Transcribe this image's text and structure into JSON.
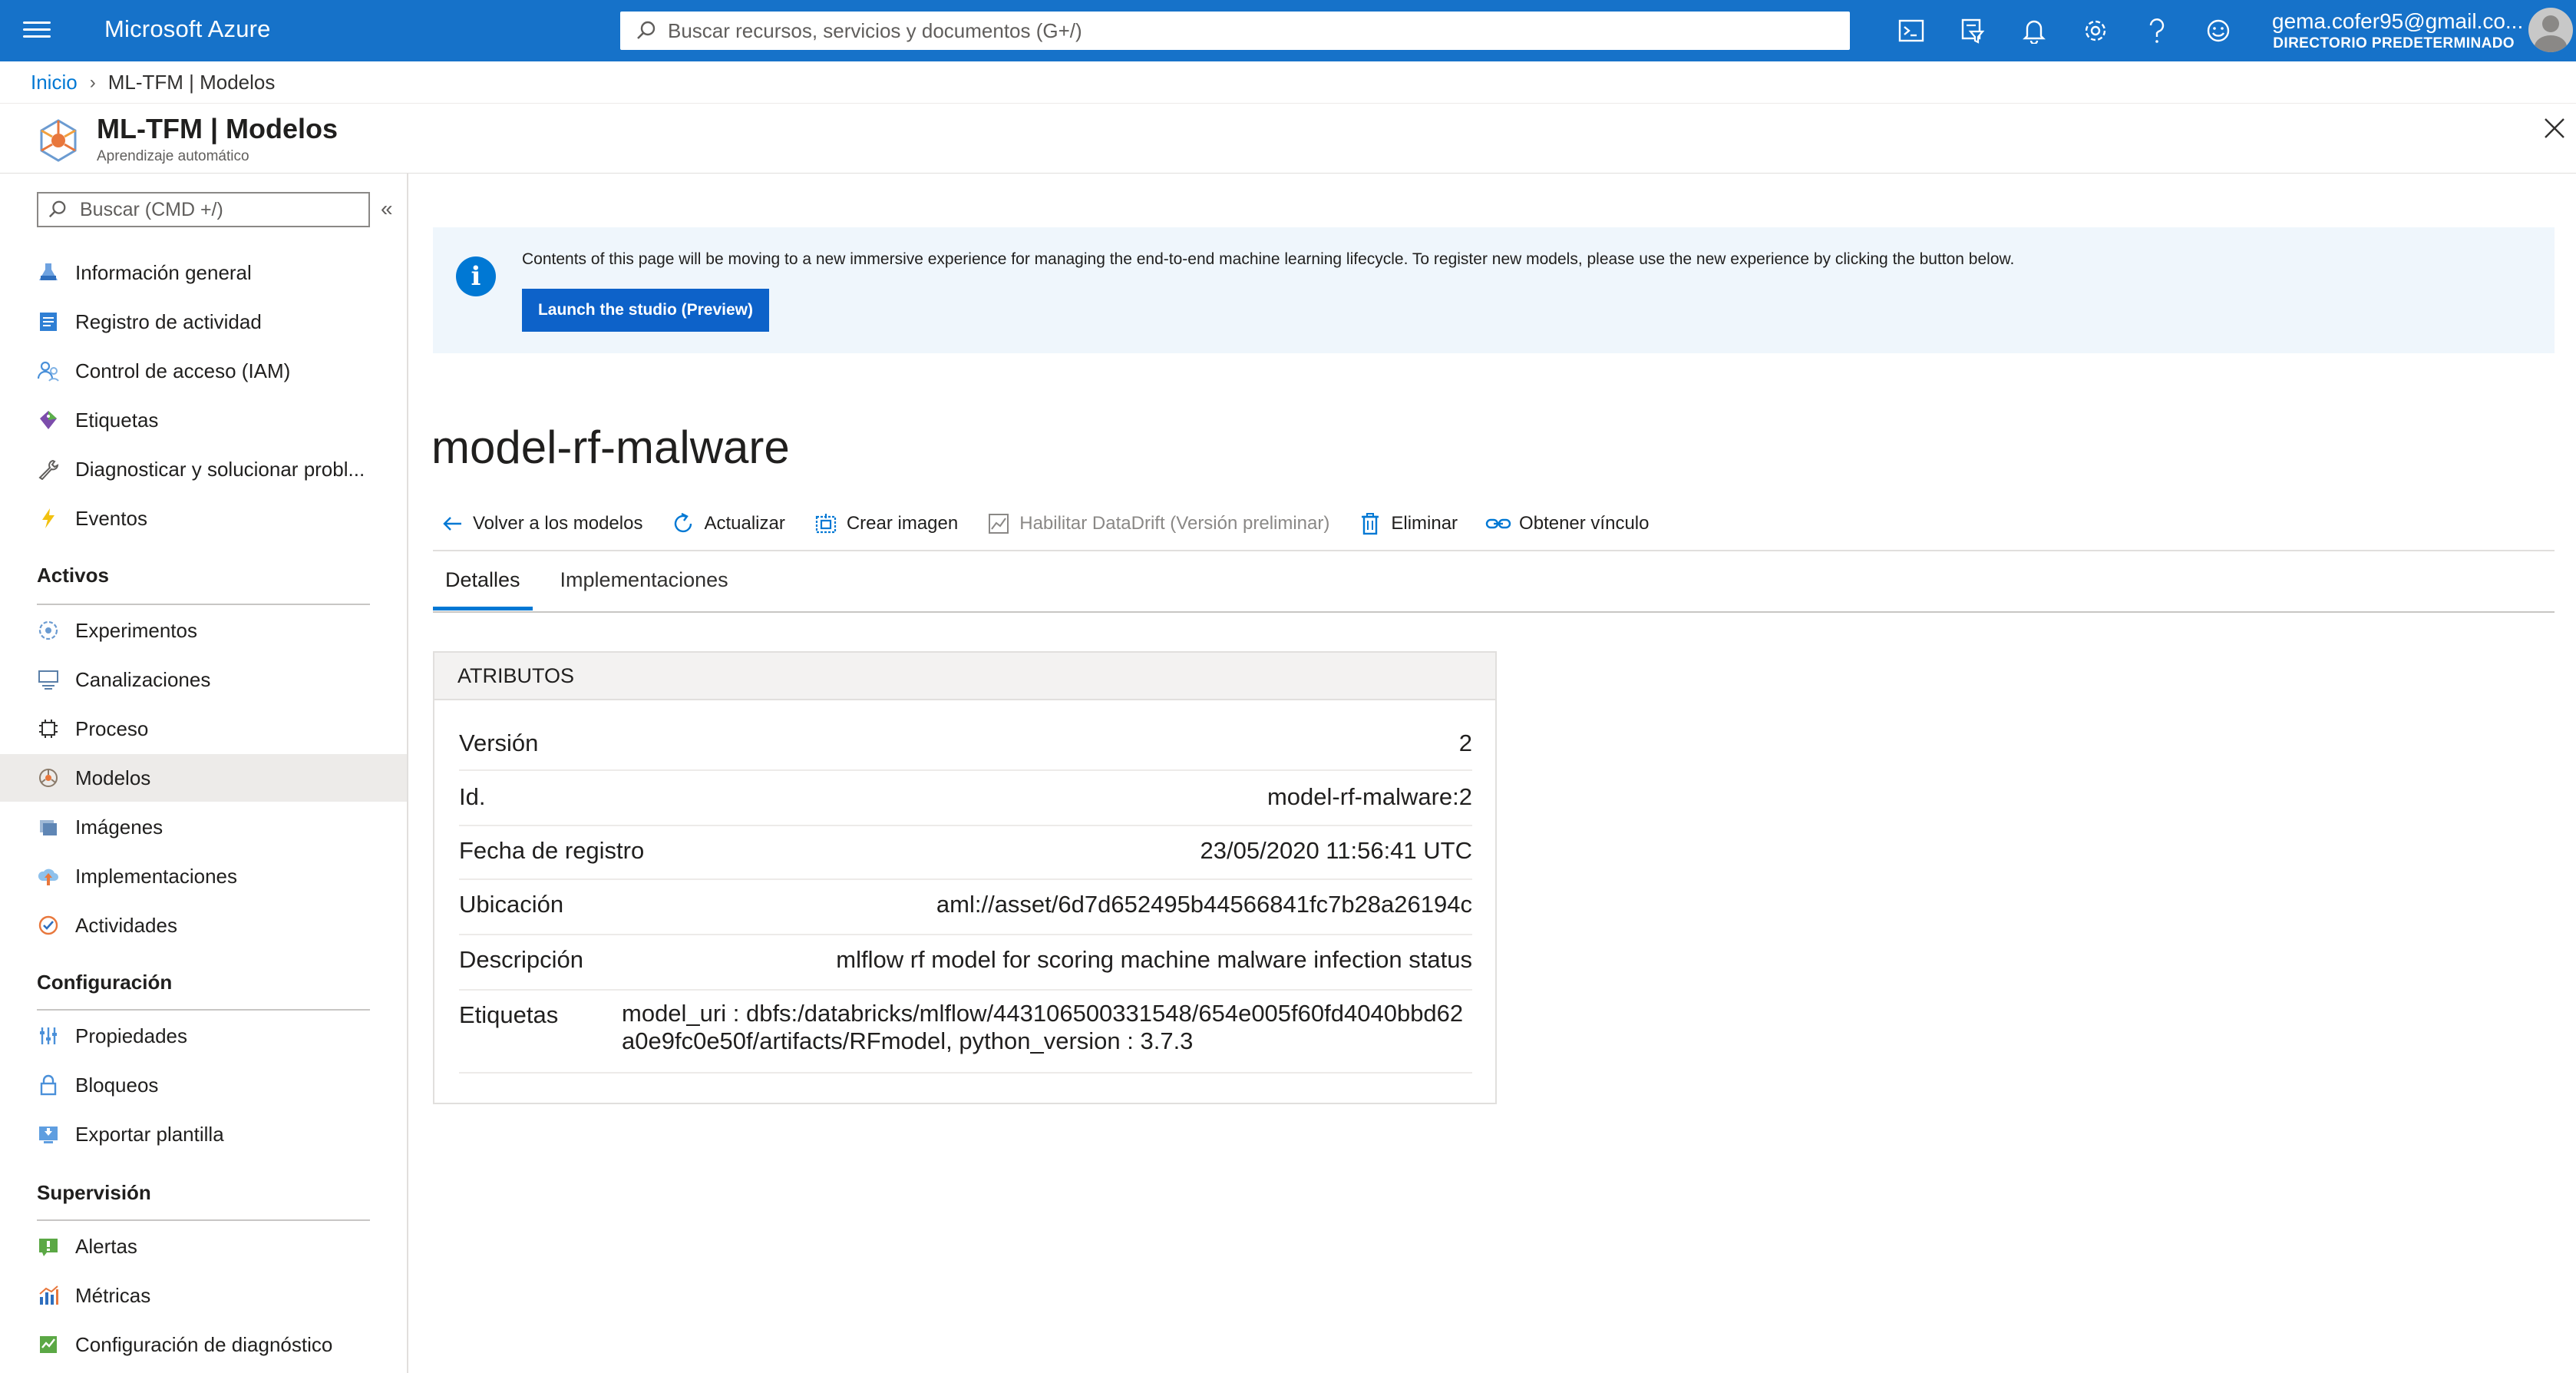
{
  "topbar": {
    "brand": "Microsoft Azure",
    "search_placeholder": "Buscar recursos, servicios y documentos (G+/)",
    "user_email": "gema.cofer95@gmail.co...",
    "user_directory": "DIRECTORIO PREDETERMINADO",
    "icons": [
      "cloud-shell-icon",
      "directory-filter-icon",
      "notifications-icon",
      "settings-icon",
      "help-icon",
      "feedback-icon"
    ]
  },
  "breadcrumb": {
    "home": "Inicio",
    "current": "ML-TFM | Modelos"
  },
  "header": {
    "title": "ML-TFM | Modelos",
    "subtitle": "Aprendizaje automático"
  },
  "sidebar": {
    "search_placeholder": "Buscar (CMD +/)",
    "items_top": [
      {
        "label": "Información general",
        "icon": "overview-icon"
      },
      {
        "label": "Registro de actividad",
        "icon": "activity-log-icon"
      },
      {
        "label": "Control de acceso (IAM)",
        "icon": "iam-icon"
      },
      {
        "label": "Etiquetas",
        "icon": "tags-icon"
      },
      {
        "label": "Diagnosticar y solucionar probl...",
        "icon": "wrench-icon"
      },
      {
        "label": "Eventos",
        "icon": "lightning-icon"
      }
    ],
    "section_activos": "Activos",
    "items_activos": [
      {
        "label": "Experimentos",
        "icon": "experiments-icon"
      },
      {
        "label": "Canalizaciones",
        "icon": "pipelines-icon"
      },
      {
        "label": "Proceso",
        "icon": "compute-icon"
      },
      {
        "label": "Modelos",
        "icon": "models-icon"
      },
      {
        "label": "Imágenes",
        "icon": "images-icon"
      },
      {
        "label": "Implementaciones",
        "icon": "deployments-icon"
      },
      {
        "label": "Actividades",
        "icon": "activities-icon"
      }
    ],
    "section_config": "Configuración",
    "items_config": [
      {
        "label": "Propiedades",
        "icon": "properties-icon"
      },
      {
        "label": "Bloqueos",
        "icon": "lock-icon"
      },
      {
        "label": "Exportar plantilla",
        "icon": "export-template-icon"
      }
    ],
    "section_supervision": "Supervisión",
    "items_supervision": [
      {
        "label": "Alertas",
        "icon": "alerts-icon"
      },
      {
        "label": "Métricas",
        "icon": "metrics-icon"
      },
      {
        "label": "Configuración de diagnóstico",
        "icon": "diagnostic-settings-icon"
      }
    ]
  },
  "banner": {
    "text": "Contents of this page will be moving to a new immersive experience for managing the end-to-end machine learning lifecycle. To register new models, please use the new experience by clicking the button below.",
    "button": "Launch the studio (Preview)"
  },
  "model": {
    "title": "model-rf-malware"
  },
  "toolbar": {
    "back": "Volver a los modelos",
    "refresh": "Actualizar",
    "create_image": "Crear imagen",
    "datadrift": "Habilitar DataDrift (Versión preliminar)",
    "delete": "Eliminar",
    "get_link": "Obtener vínculo"
  },
  "tabs": [
    "Detalles",
    "Implementaciones"
  ],
  "attributes": {
    "header": "ATRIBUTOS",
    "rows": [
      {
        "key": "Versión",
        "value": "2"
      },
      {
        "key": "Id.",
        "value": "model-rf-malware:2"
      },
      {
        "key": "Fecha de registro",
        "value": "23/05/2020 11:56:41 UTC"
      },
      {
        "key": "Ubicación",
        "value": "aml://asset/6d7d652495b44566841fc7b28a26194c"
      },
      {
        "key": "Descripción",
        "value": "mlflow rf model for scoring machine malware infection status"
      },
      {
        "key": "Etiquetas",
        "value": "model_uri : dbfs:/databricks/mlflow/443106500331548/654e005f60fd4040bbd62a0e9fc0e50f/artifacts/RFmodel, python_version : 3.7.3"
      }
    ]
  }
}
